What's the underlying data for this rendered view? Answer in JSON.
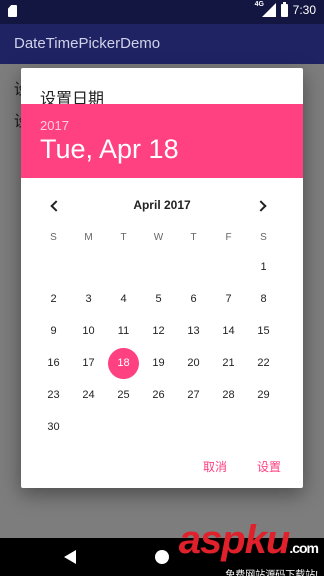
{
  "status_bar": {
    "network": "4G",
    "time": "7:30"
  },
  "app_bar": {
    "title": "DateTimePickerDemo"
  },
  "background": {
    "line1": "设",
    "line2": "设"
  },
  "dialog": {
    "title": "设置日期",
    "header": {
      "year": "2017",
      "date": "Tue, Apr 18"
    },
    "month_label": "April 2017",
    "weekdays": [
      "S",
      "M",
      "T",
      "W",
      "T",
      "F",
      "S"
    ],
    "weeks": [
      [
        "",
        "",
        "",
        "",
        "",
        "",
        "1"
      ],
      [
        "2",
        "3",
        "4",
        "5",
        "6",
        "7",
        "8"
      ],
      [
        "9",
        "10",
        "11",
        "12",
        "13",
        "14",
        "15"
      ],
      [
        "16",
        "17",
        "18",
        "19",
        "20",
        "21",
        "22"
      ],
      [
        "23",
        "24",
        "25",
        "26",
        "27",
        "28",
        "29"
      ],
      [
        "30",
        "",
        "",
        "",
        "",
        "",
        ""
      ]
    ],
    "selected_day": "18",
    "cancel_label": "取消",
    "ok_label": "设置"
  },
  "colors": {
    "accent": "#ff4081",
    "app_bar": "#1f2364",
    "status_bar": "#121640"
  },
  "watermark": {
    "logo": "aspku",
    "suffix": ".com",
    "subtitle": "免费网站源码下载站!"
  }
}
